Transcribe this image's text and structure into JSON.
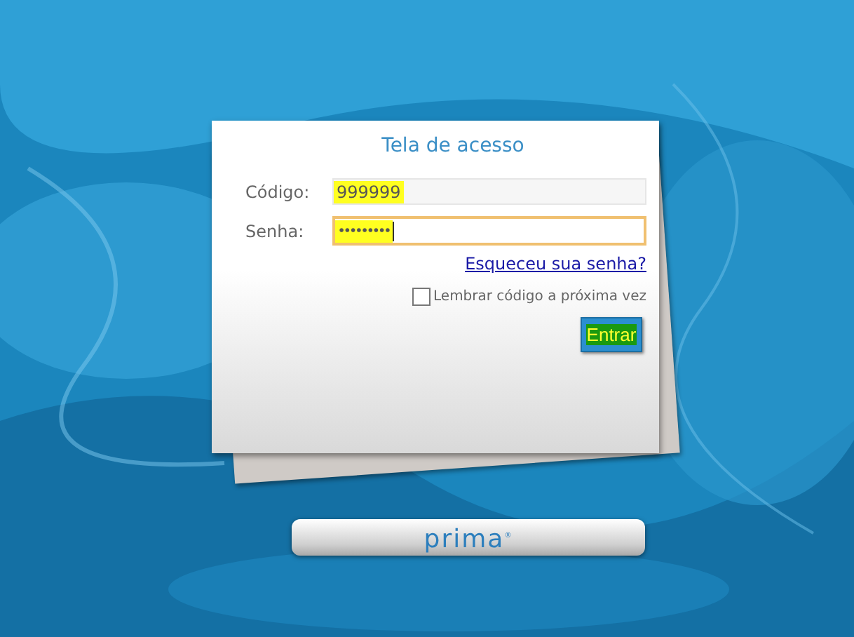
{
  "login": {
    "title": "Tela de acesso",
    "fields": [
      {
        "label": "Código:",
        "value": "999999",
        "kind": "text",
        "focused": false,
        "highlighted": true
      },
      {
        "label": "Senha:",
        "value": "•••••••••",
        "kind": "password",
        "focused": true,
        "highlighted": true
      }
    ],
    "forgot_link": "Esqueceu sua senha?",
    "remember": {
      "label": "Lembrar código a próxima vez",
      "checked": false
    },
    "submit": {
      "label": "Entrar",
      "highlighted": true
    }
  },
  "footer": {
    "logo": "prima",
    "logo_mark": "®"
  }
}
